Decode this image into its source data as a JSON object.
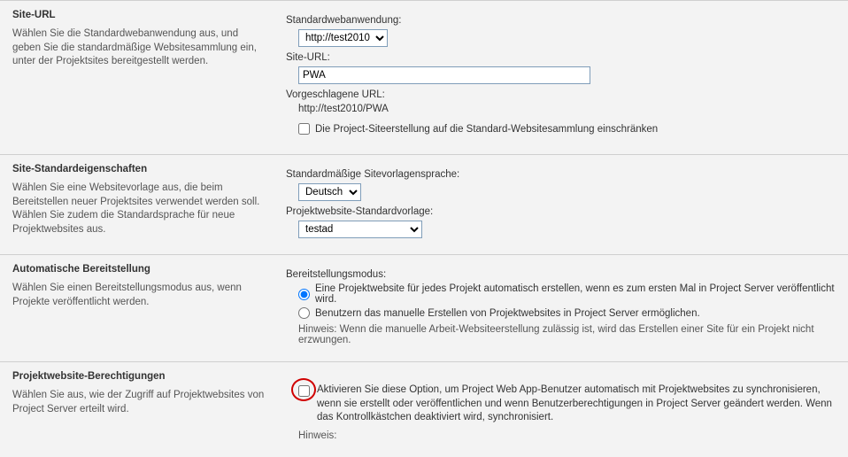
{
  "siteUrl": {
    "title": "Site-URL",
    "desc": "Wählen Sie die Standardwebanwendung aus, und geben Sie die standardmäßige Websitesammlung ein, unter der Projektsites bereitgestellt werden.",
    "stdWebAppLabel": "Standardwebanwendung:",
    "stdWebAppValue": "http://test2010",
    "siteUrlLabel": "Site-URL:",
    "siteUrlValue": "PWA",
    "suggUrlLabel": "Vorgeschlagene URL:",
    "suggUrlValue": "http://test2010/PWA",
    "restrictCb": "Die Project-Siteerstellung auf die Standard-Websitesammlung einschränken"
  },
  "siteStd": {
    "title": "Site-Standardeigenschaften",
    "desc": "Wählen Sie eine Websitevorlage aus, die beim Bereitstellen neuer Projektsites verwendet werden soll. Wählen Sie zudem die Standardsprache für neue Projektwebsites aus.",
    "langLabel": "Standardmäßige Sitevorlagensprache:",
    "langValue": "Deutsch",
    "templateLabel": "Projektwebsite-Standardvorlage:",
    "templateValue": "testad"
  },
  "autoProv": {
    "title": "Automatische Bereitstellung",
    "desc": "Wählen Sie einen Bereitstellungsmodus aus, wenn Projekte veröffentlicht werden.",
    "modeLabel": "Bereitstellungsmodus:",
    "opt1": "Eine Projektwebsite für jedes Projekt automatisch erstellen, wenn es zum ersten Mal in Project Server veröffentlicht wird.",
    "opt2": "Benutzern das manuelle Erstellen von Projektwebsites in Project Server ermöglichen.",
    "hint": "Hinweis: Wenn die manuelle Arbeit-Websiteerstellung zulässig ist, wird das Erstellen einer Site für ein Projekt nicht erzwungen."
  },
  "perms": {
    "title": "Projektwebsite-Berechtigungen",
    "desc": "Wählen Sie aus, wie der Zugriff auf Projektwebsites von Project Server erteilt wird.",
    "optText": "Aktivieren Sie diese Option, um Project Web App-Benutzer automatisch mit Projektwebsites zu synchronisieren, wenn sie erstellt oder veröffentlichen und wenn Benutzerberechtigungen in Project Server geändert werden. Wenn das Kontrollkästchen deaktiviert wird, synchronisiert.",
    "hintLabel": "Hinweis:"
  }
}
